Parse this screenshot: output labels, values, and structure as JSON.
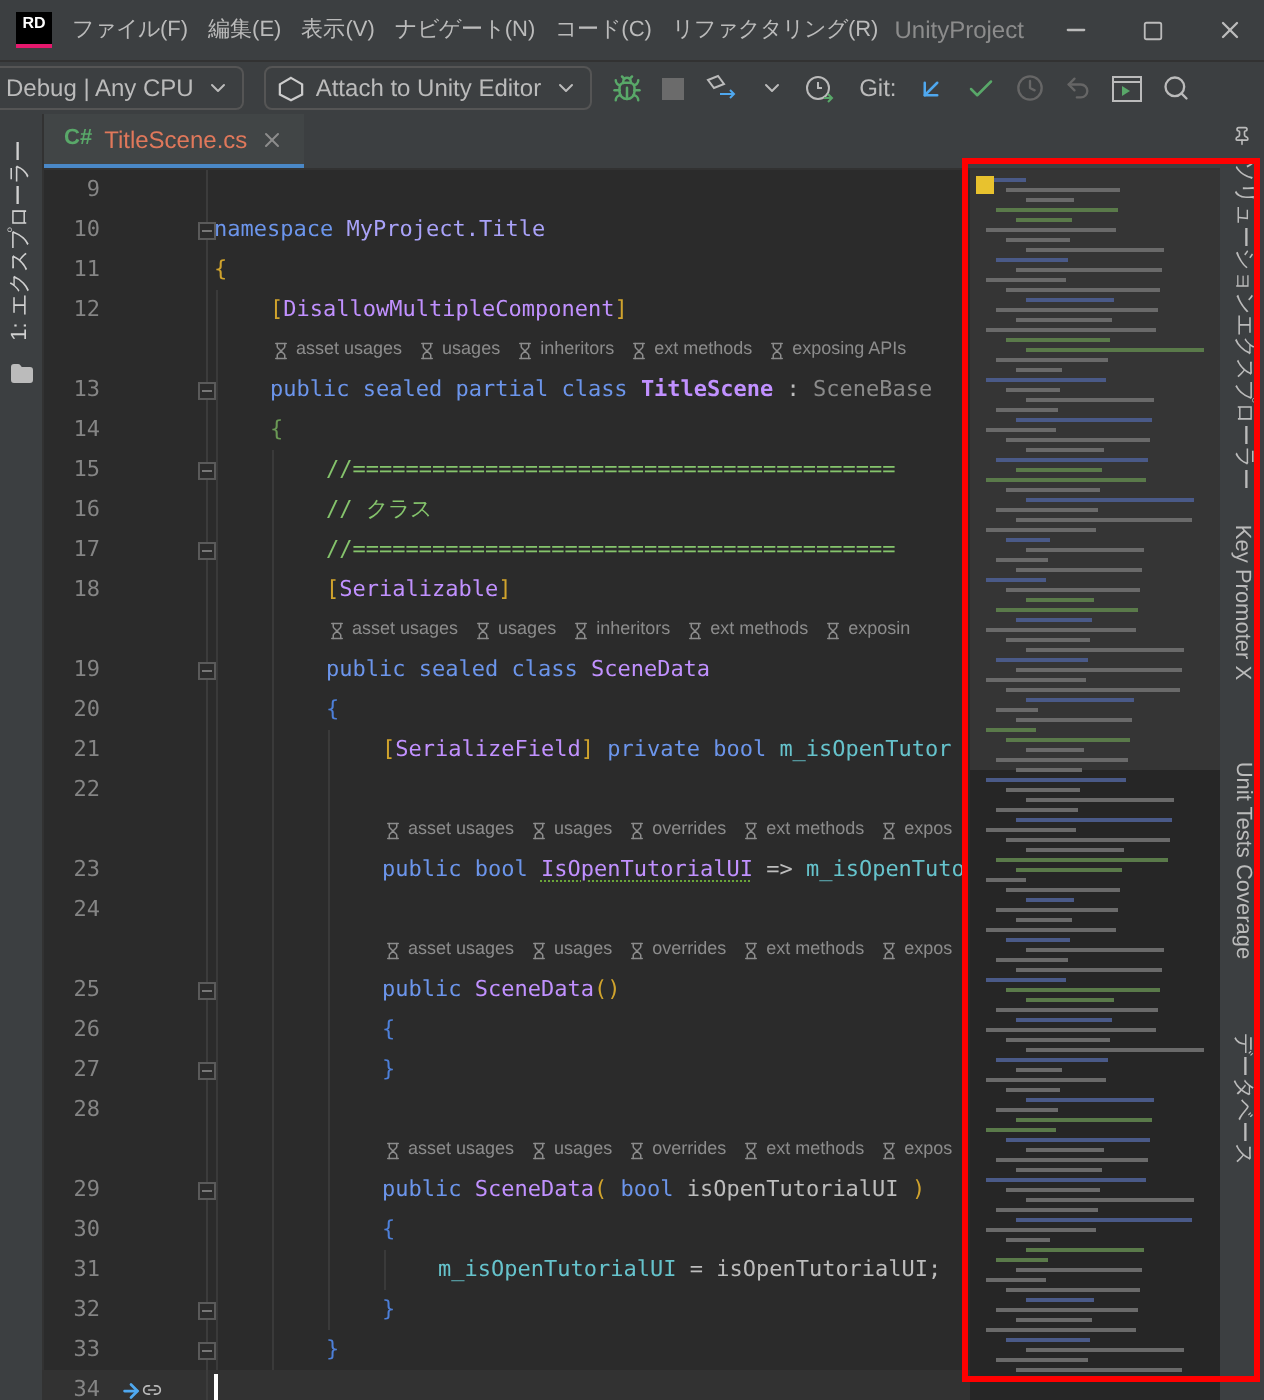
{
  "window": {
    "logo": "RD",
    "menu": [
      "ファイル(F)",
      "編集(E)",
      "表示(V)",
      "ナビゲート(N)",
      "コード(C)",
      "リファクタリング(R)"
    ],
    "project": "UnityProject"
  },
  "toolbar": {
    "configuration": "Debug | Any CPU",
    "run_target": "Attach to Unity Editor",
    "git_label": "Git:"
  },
  "left_panel": {
    "label": "1: エクスプローラー"
  },
  "tabs": [
    {
      "lang": "C#",
      "label": "TitleScene.cs",
      "selected": true
    }
  ],
  "right_panel": {
    "labels": [
      "ソリューションエクスプローラー",
      "Key Promoter X",
      "Unit Tests Coverage",
      "データベース"
    ]
  },
  "code": [
    {
      "kind": "line",
      "number": "9",
      "fold": false
    },
    {
      "kind": "line",
      "number": "10",
      "fold": true,
      "tokens": [
        {
          "text": "namespace ",
          "kind": "keyword"
        },
        {
          "text": "MyProject.Title",
          "kind": "namespace"
        }
      ]
    },
    {
      "kind": "line",
      "number": "11",
      "fold": false,
      "tokens": [
        {
          "text": "{",
          "kind": "brace-gold"
        }
      ],
      "children": [
        {
          "kind": "line",
          "number": "12",
          "fold": false,
          "tokens": [
            {
              "text": "[",
              "kind": "brace-gold"
            },
            {
              "text": "DisallowMultipleComponent",
              "kind": "type"
            },
            {
              "text": "]",
              "kind": "brace-gold"
            }
          ]
        },
        {
          "kind": "hints",
          "items": [
            "asset usages",
            "usages",
            "inheritors",
            "ext methods",
            "exposing APIs"
          ]
        },
        {
          "kind": "line",
          "number": "13",
          "fold": true,
          "tokens": [
            {
              "text": "public sealed partial class ",
              "kind": "keyword"
            },
            {
              "text": "TitleScene",
              "kind": "type-bold"
            },
            {
              "text": " : ",
              "kind": "plain"
            },
            {
              "text": "SceneBase",
              "kind": "dim"
            }
          ]
        },
        {
          "kind": "line",
          "number": "14",
          "fold": false,
          "tokens": [
            {
              "text": "{",
              "kind": "brace-green"
            }
          ],
          "children": [
            {
              "kind": "line",
              "number": "15",
              "fold": true,
              "tokens": [
                {
                  "text": "//=========================================",
                  "kind": "comment"
                }
              ]
            },
            {
              "kind": "line",
              "number": "16",
              "fold": false,
              "tokens": [
                {
                  "text": "// クラス",
                  "kind": "comment"
                }
              ]
            },
            {
              "kind": "line",
              "number": "17",
              "fold": true,
              "tokens": [
                {
                  "text": "//=========================================",
                  "kind": "comment"
                }
              ]
            },
            {
              "kind": "line",
              "number": "18",
              "fold": false,
              "tokens": [
                {
                  "text": "[",
                  "kind": "brace-gold"
                },
                {
                  "text": "Serializable",
                  "kind": "type"
                },
                {
                  "text": "]",
                  "kind": "brace-gold"
                }
              ]
            },
            {
              "kind": "hints",
              "items": [
                "asset usages",
                "usages",
                "inheritors",
                "ext methods",
                "exposin"
              ]
            },
            {
              "kind": "line",
              "number": "19",
              "fold": true,
              "tokens": [
                {
                  "text": "public sealed class ",
                  "kind": "keyword"
                },
                {
                  "text": "SceneData",
                  "kind": "type"
                }
              ]
            },
            {
              "kind": "line",
              "number": "20",
              "fold": false,
              "tokens": [
                {
                  "text": "{",
                  "kind": "brace-blue"
                }
              ],
              "children": [
                {
                  "kind": "line",
                  "number": "21",
                  "fold": false,
                  "tokens": [
                    {
                      "text": "[",
                      "kind": "brace-gold"
                    },
                    {
                      "text": "SerializeField",
                      "kind": "type"
                    },
                    {
                      "text": "]",
                      "kind": "brace-gold"
                    },
                    {
                      "text": " private bool ",
                      "kind": "keyword"
                    },
                    {
                      "text": "m_isOpenTutor",
                      "kind": "field"
                    }
                  ]
                },
                {
                  "kind": "line",
                  "number": "22",
                  "fold": false
                },
                {
                  "kind": "hints",
                  "items": [
                    "asset usages",
                    "usages",
                    "overrides",
                    "ext methods",
                    "expos"
                  ]
                },
                {
                  "kind": "line",
                  "number": "23",
                  "fold": false,
                  "tokens": [
                    {
                      "text": "public bool ",
                      "kind": "keyword"
                    },
                    {
                      "text": "IsOpenTutorialUI",
                      "kind": "property",
                      "underlined": true
                    },
                    {
                      "text": " => ",
                      "kind": "plain"
                    },
                    {
                      "text": "m_isOpenTuto",
                      "kind": "field"
                    }
                  ]
                },
                {
                  "kind": "line",
                  "number": "24",
                  "fold": false
                },
                {
                  "kind": "hints",
                  "items": [
                    "asset usages",
                    "usages",
                    "overrides",
                    "ext methods",
                    "expos"
                  ]
                },
                {
                  "kind": "line",
                  "number": "25",
                  "fold": true,
                  "tokens": [
                    {
                      "text": "public ",
                      "kind": "keyword"
                    },
                    {
                      "text": "SceneData",
                      "kind": "type"
                    },
                    {
                      "text": "()",
                      "kind": "brace-gold"
                    }
                  ]
                },
                {
                  "kind": "line",
                  "number": "26",
                  "fold": false,
                  "tokens": [
                    {
                      "text": "{",
                      "kind": "brace-blue"
                    }
                  ]
                },
                {
                  "kind": "line",
                  "number": "27",
                  "fold": true,
                  "tokens": [
                    {
                      "text": "}",
                      "kind": "brace-blue"
                    }
                  ]
                },
                {
                  "kind": "line",
                  "number": "28",
                  "fold": false
                },
                {
                  "kind": "hints",
                  "items": [
                    "asset usages",
                    "usages",
                    "overrides",
                    "ext methods",
                    "expos"
                  ]
                },
                {
                  "kind": "line",
                  "number": "29",
                  "fold": true,
                  "tokens": [
                    {
                      "text": "public ",
                      "kind": "keyword"
                    },
                    {
                      "text": "SceneData",
                      "kind": "type"
                    },
                    {
                      "text": "(",
                      "kind": "brace-gold"
                    },
                    {
                      "text": " bool",
                      "kind": "keyword"
                    },
                    {
                      "text": " isOpenTutorialUI ",
                      "kind": "plain"
                    },
                    {
                      "text": ")",
                      "kind": "brace-gold"
                    }
                  ]
                },
                {
                  "kind": "line",
                  "number": "30",
                  "fold": false,
                  "tokens": [
                    {
                      "text": "{",
                      "kind": "brace-blue"
                    }
                  ],
                  "children": [
                    {
                      "kind": "line",
                      "number": "31",
                      "fold": false,
                      "tokens": [
                        {
                          "text": "m_isOpenTutorialUI",
                          "kind": "field"
                        },
                        {
                          "text": " = isOpenTutorialUI;",
                          "kind": "plain"
                        }
                      ]
                    }
                  ]
                },
                {
                  "kind": "line",
                  "number": "32",
                  "fold": true,
                  "tokens": [
                    {
                      "text": "}",
                      "kind": "brace-blue"
                    }
                  ]
                }
              ]
            },
            {
              "kind": "line",
              "number": "33",
              "fold": true,
              "tokens": [
                {
                  "text": "}",
                  "kind": "brace-blue"
                }
              ]
            }
          ]
        }
      ]
    },
    {
      "kind": "line",
      "number": "34",
      "fold": false,
      "cursor": true
    }
  ]
}
